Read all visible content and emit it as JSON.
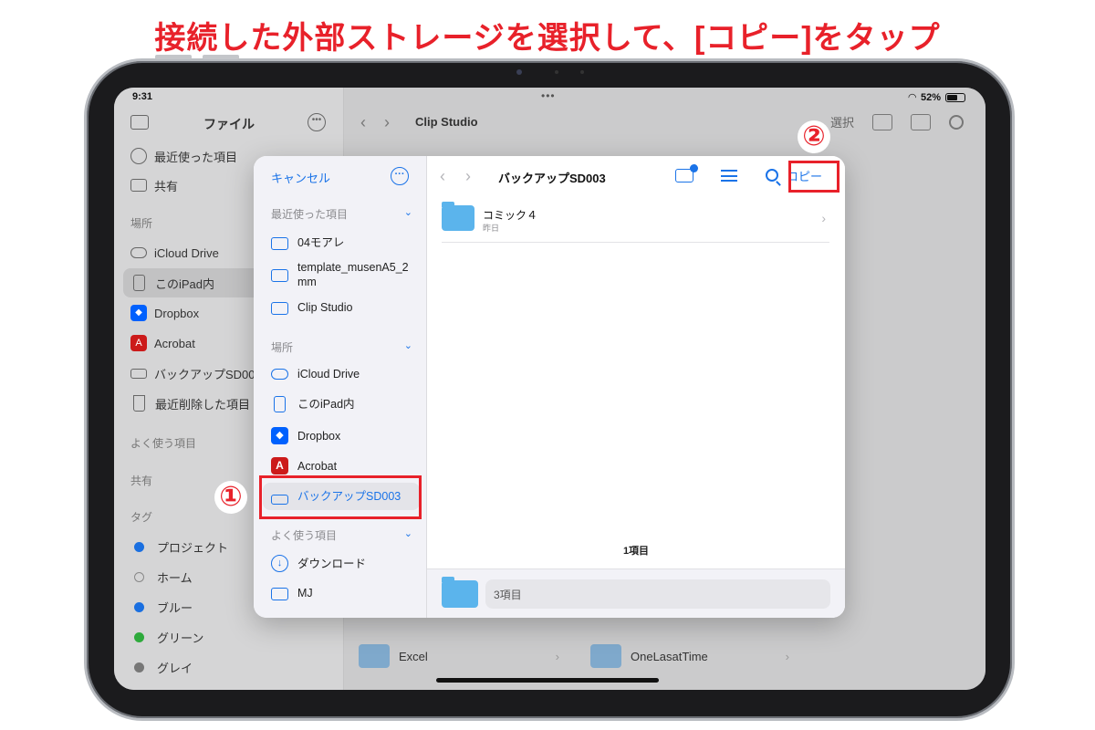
{
  "headline": "接続した外部ストレージを選択して、[コピー]をタップ",
  "status": {
    "time": "9:31",
    "dots": "•••",
    "battery_pct": "52%"
  },
  "background_app": {
    "sidebar_title": "ファイル",
    "items": [
      {
        "label": "最近使った項目",
        "icon": "clock-icon"
      },
      {
        "label": "共有",
        "icon": "shared-folder-icon"
      }
    ],
    "locations_header": "場所",
    "locations": [
      {
        "label": "iCloud Drive",
        "icon": "cloud-icon"
      },
      {
        "label": "このiPad内",
        "icon": "ipad-icon"
      },
      {
        "label": "Dropbox",
        "icon": "dropbox-icon"
      },
      {
        "label": "Acrobat",
        "icon": "acrobat-icon"
      },
      {
        "label": "バックアップSD003",
        "icon": "drive-icon"
      },
      {
        "label": "最近削除した項目",
        "icon": "trash-icon"
      }
    ],
    "favorites_header": "よく使う項目",
    "shared_header": "共有",
    "tags_header": "タグ",
    "tags": [
      {
        "label": "プロジェクト",
        "color": "#1a6fe0"
      },
      {
        "label": "ホーム",
        "color": ""
      },
      {
        "label": "ブルー",
        "color": "#1a6fe0"
      },
      {
        "label": "グリーン",
        "color": "#2eaa3c"
      },
      {
        "label": "グレイ",
        "color": "#777777"
      }
    ],
    "path": "Clip Studio",
    "select_label": "選択",
    "rows": [
      {
        "name": "Excel"
      },
      {
        "name": "OneLasatTime"
      }
    ]
  },
  "modal": {
    "cancel": "キャンセル",
    "recent_header": "最近使った項目",
    "recent": [
      {
        "label": "04モアレ"
      },
      {
        "label": "template_musenA5_2mm"
      },
      {
        "label": "Clip Studio"
      }
    ],
    "locations_header": "場所",
    "locations": [
      {
        "label": "iCloud Drive"
      },
      {
        "label": "このiPad内"
      },
      {
        "label": "Dropbox"
      },
      {
        "label": "Acrobat"
      },
      {
        "label": "バックアップSD003"
      }
    ],
    "favorites_header": "よく使う項目",
    "favorites": [
      {
        "label": "ダウンロード"
      },
      {
        "label": "MJ"
      }
    ],
    "title": "バックアップSD003",
    "copy_button": "コピー",
    "files": [
      {
        "name": "コミック４",
        "date": "昨日"
      }
    ],
    "item_count": "1項目",
    "bottom_field": "3項目"
  },
  "annotations": {
    "step1": "①",
    "step2": "②"
  },
  "colors": {
    "accent": "#1a73e8",
    "highlight": "#e8212a"
  }
}
